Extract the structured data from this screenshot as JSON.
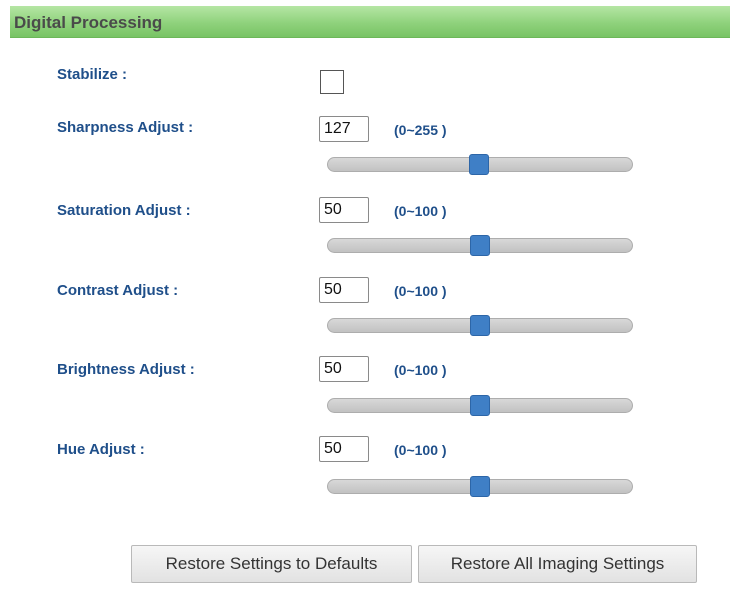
{
  "section": {
    "title": "Digital Processing"
  },
  "stabilize": {
    "label": "Stabilize :",
    "checked": false
  },
  "settings": [
    {
      "label": "Sharpness Adjust :",
      "value": "127",
      "range": "(0~255 )",
      "min": 0,
      "max": 255
    },
    {
      "label": "Saturation Adjust :",
      "value": "50",
      "range": "(0~100 )",
      "min": 0,
      "max": 100
    },
    {
      "label": "Contrast Adjust :",
      "value": "50",
      "range": "(0~100 )",
      "min": 0,
      "max": 100
    },
    {
      "label": "Brightness Adjust :",
      "value": "50",
      "range": "(0~100 )",
      "min": 0,
      "max": 100
    },
    {
      "label": "Hue Adjust :",
      "value": "50",
      "range": "(0~100 )",
      "min": 0,
      "max": 100
    }
  ],
  "buttons": {
    "restore_defaults": "Restore Settings to Defaults",
    "restore_all": "Restore All Imaging Settings"
  },
  "colors": {
    "header_green": "#8fd27c",
    "label_blue": "#1f4f8a",
    "slider_thumb": "#3f7fc6"
  }
}
